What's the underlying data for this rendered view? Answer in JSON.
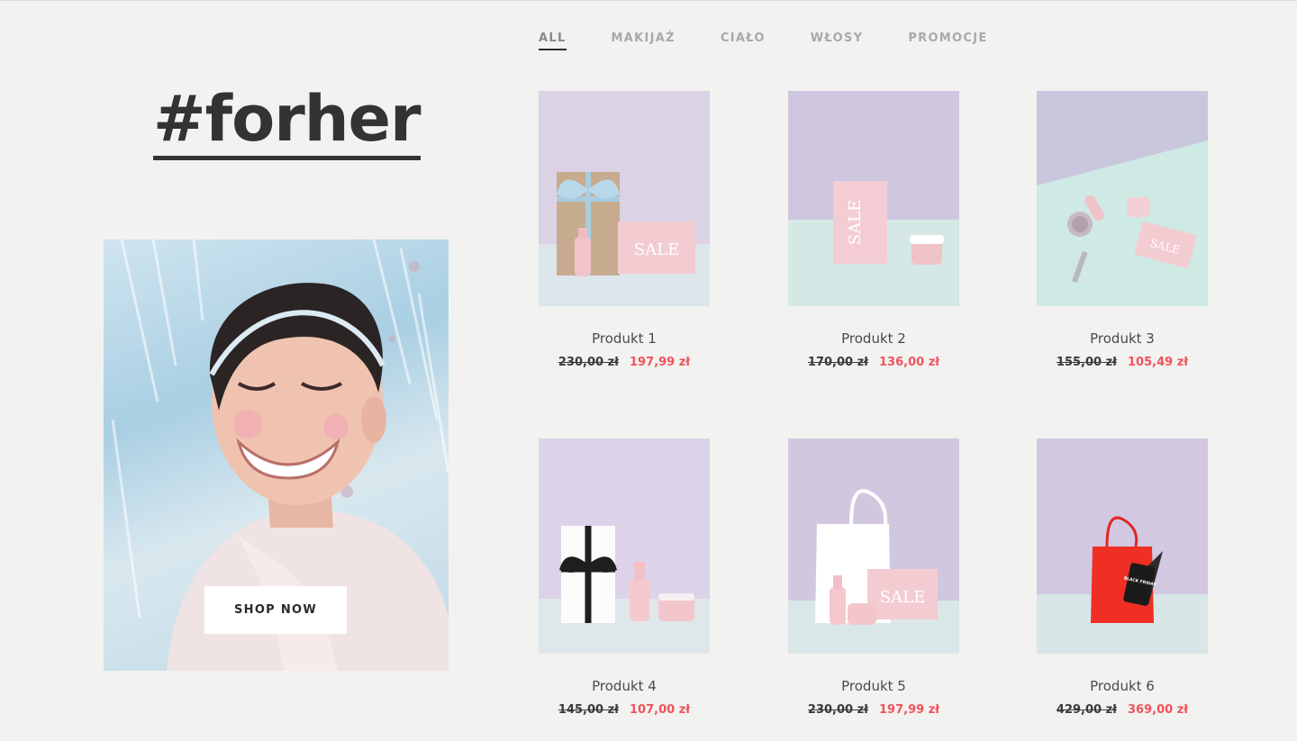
{
  "hero": {
    "hashtag": "#forher",
    "cta_label": "SHOP NOW"
  },
  "tabs": [
    {
      "label": "ALL",
      "active": true
    },
    {
      "label": "MAKIJAŻ",
      "active": false
    },
    {
      "label": "CIAŁO",
      "active": false
    },
    {
      "label": "WŁOSY",
      "active": false
    },
    {
      "label": "PROMOCJE",
      "active": false
    }
  ],
  "products": [
    {
      "name": "Produkt 1",
      "old_price": "230,00 zł",
      "price": "197,99 zł"
    },
    {
      "name": "Produkt 2",
      "old_price": "170,00 zł",
      "price": "136,00 zł"
    },
    {
      "name": "Produkt 3",
      "old_price": "155,00 zł",
      "price": "105,49 zł"
    },
    {
      "name": "Produkt 4",
      "old_price": "145,00 zł",
      "price": "107,00 zł"
    },
    {
      "name": "Produkt 5",
      "old_price": "230,00 zł",
      "price": "197,99 zł"
    },
    {
      "name": "Produkt 6",
      "old_price": "429,00 zł",
      "price": "369,00 zł"
    }
  ],
  "image_labels": {
    "sale": "SALE",
    "black_friday": "BLACK FRIDAY"
  },
  "colors": {
    "background": "#f2f2f0",
    "sale_price": "#f0535d",
    "text": "#3b3b3b"
  }
}
